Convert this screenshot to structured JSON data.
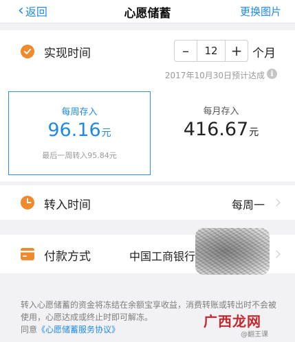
{
  "nav": {
    "back_label": "返回",
    "title": "心愿储蓄",
    "right_label": "更换图片"
  },
  "realize": {
    "label": "实现时间",
    "months_value": "12",
    "minus": "–",
    "plus": "+",
    "unit": "个月",
    "estimate": "2017年10月30日预计达成",
    "info_symbol": "i"
  },
  "plans": {
    "weekly": {
      "label": "每周存入",
      "amount": "96.16",
      "unit": "元",
      "note": "最后一周转入95.84元",
      "selected": true
    },
    "monthly": {
      "label": "每月存入",
      "amount": "416.67",
      "unit": "元",
      "selected": false
    }
  },
  "transfer": {
    "label": "转入时间",
    "value": "每周一"
  },
  "payment": {
    "label": "付款方式",
    "value": "中国工商银行"
  },
  "footer": {
    "notice": "转入心愿储蓄的资金将冻结在余额宝享收益，消费转账或转出时不会被使用，心愿达成或终止时即可解冻。",
    "agree_prefix": "同意",
    "agreement_link": "《心愿储蓄服务协议》"
  },
  "watermark": {
    "main": "广西龙网",
    "sub": "@翻王课"
  },
  "colors": {
    "accent_blue": "#1e8ae6",
    "icon_orange": "#f08a2e",
    "background": "#f2f2f4"
  }
}
